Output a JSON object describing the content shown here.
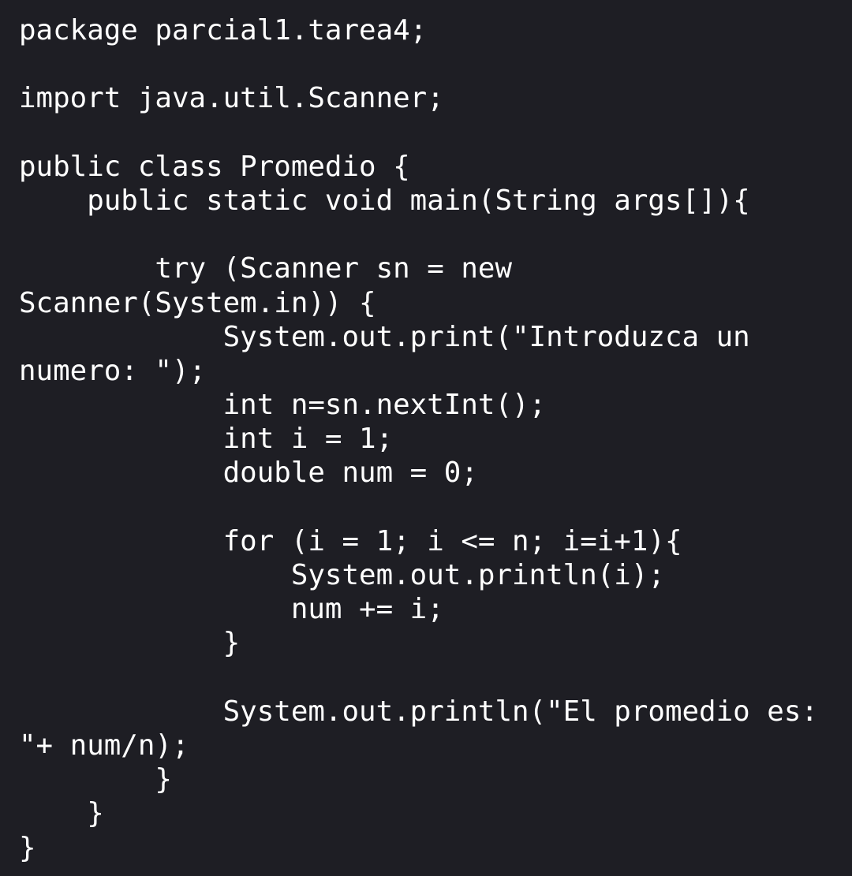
{
  "editor": {
    "lines": [
      "package parcial1.tarea4;",
      "",
      "import java.util.Scanner;",
      "",
      "public class Promedio {",
      "    public static void main(String args[]){",
      "",
      "        try (Scanner sn = new",
      "Scanner(System.in)) {",
      "            System.out.print(\"Introduzca un",
      "numero: \");",
      "            int n=sn.nextInt();",
      "            int i = 1;",
      "            double num = 0;",
      "",
      "            for (i = 1; i <= n; i=i+1){",
      "                System.out.println(i);",
      "                num += i;",
      "            }",
      "",
      "            System.out.println(\"El promedio es:",
      "\"+ num/n);",
      "        }",
      "    }",
      "}"
    ],
    "colors": {
      "background": "#1e1e24",
      "text": "#ffffff"
    }
  }
}
